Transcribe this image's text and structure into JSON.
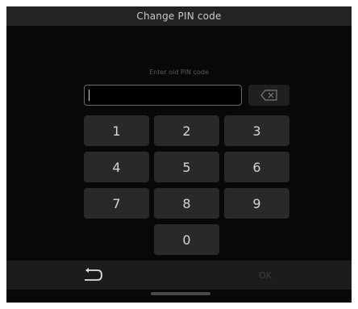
{
  "header": {
    "title": "Change PIN code"
  },
  "pin": {
    "prompt": "Enter old PIN code",
    "value": ""
  },
  "keypad": {
    "keys": [
      "1",
      "2",
      "3",
      "4",
      "5",
      "6",
      "7",
      "8",
      "9",
      "0"
    ]
  },
  "bottom": {
    "ok_label": "OK"
  },
  "icons": {
    "backspace": "backspace-icon",
    "back": "back-arrow-icon"
  },
  "colors": {
    "background": "#080808",
    "key": "#292929",
    "text": "#d6d6d6"
  }
}
